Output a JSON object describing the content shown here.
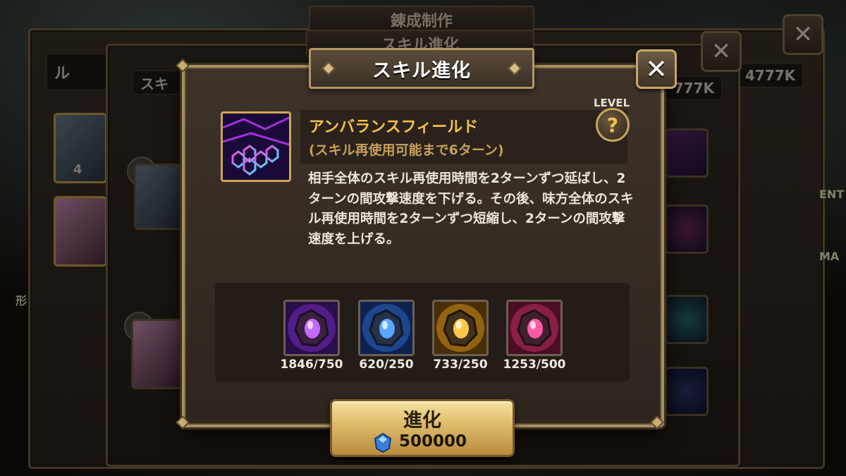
{
  "background": {
    "back_tab_1": "錬成制作",
    "back_tab_2": "スキル進化",
    "back_label_left": "スキ",
    "back_label_ru": "ル",
    "back_value_1": "777K",
    "back_value_2": "4777K",
    "back_close": "✕",
    "back_side_text_1": "ENT",
    "back_side_text_2": "MA",
    "back_side_text_3": "形",
    "back_card_count": "4"
  },
  "dialog": {
    "title": "スキル進化",
    "close_label": "✕",
    "skill": {
      "name": "アンバランスフィールド",
      "cooldown": "(スキル再使用可能まで6ターン)",
      "level_label": "LEVEL",
      "level_help": "?",
      "description": "相手全体のスキル再使用時間を2ターンずつ延ばし、2ターンの間攻撃速度を下げる。その後、味方全体のスキル再使用時間を2ターンずつ短縮し、2ターンの間攻撃速度を上げる。"
    },
    "materials": [
      {
        "icon": "violet-rune-essence-icon",
        "count": "1846/750",
        "color": "#9b3cff"
      },
      {
        "icon": "blue-rune-essence-icon",
        "count": "620/250",
        "color": "#3a8cff"
      },
      {
        "icon": "gold-rune-essence-icon",
        "count": "733/250",
        "color": "#ffb61e"
      },
      {
        "icon": "magenta-rune-essence-icon",
        "count": "1253/500",
        "color": "#ff3c8a"
      }
    ],
    "evolve_button": {
      "label": "進化",
      "cost": "500000",
      "cost_icon": "crystal-icon"
    }
  }
}
